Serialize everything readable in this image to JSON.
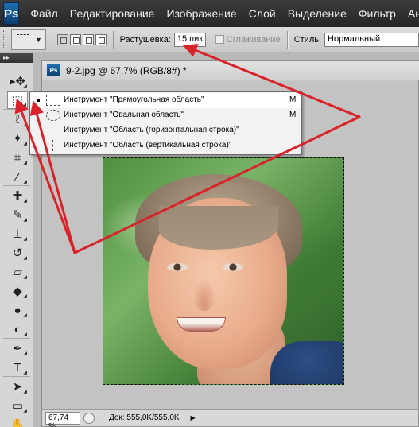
{
  "app": {
    "logo": "Ps"
  },
  "menu": [
    "Файл",
    "Редактирование",
    "Изображение",
    "Слой",
    "Выделение",
    "Фильтр",
    "Анализ"
  ],
  "options_bar": {
    "feather_label": "Растушевка:",
    "feather_value": "15 пик",
    "antialias_label": "Сглаживание",
    "style_label": "Стиль:",
    "style_value": "Нормальный"
  },
  "document": {
    "title": "9-2.jpg @ 67,7% (RGB/8#) *",
    "zoom": "67,74 %",
    "doc_info": "Док: 555,0K/555,0K"
  },
  "flyout": {
    "items": [
      {
        "label": "Инструмент \"Прямоугольная область\"",
        "key": "M",
        "icon": "rect-marquee-icon",
        "active": true
      },
      {
        "label": "Инструмент \"Овальная область\"",
        "key": "M",
        "icon": "ellipse-marquee-icon",
        "active": false
      },
      {
        "label": "Инструмент \"Область (горизонтальная строка)\"",
        "key": "",
        "icon": "single-row-marquee-icon",
        "active": false
      },
      {
        "label": "Инструмент \"Область (вертикальная строка)\"",
        "key": "",
        "icon": "single-column-marquee-icon",
        "active": false
      }
    ]
  },
  "toolbox": {
    "tools": [
      {
        "name": "move-tool-icon",
        "glyph": "▸✥"
      },
      {
        "name": "marquee-tool-icon",
        "glyph": "⬚",
        "selected": true
      },
      {
        "name": "lasso-tool-icon",
        "glyph": "ℓ"
      },
      {
        "name": "magic-wand-tool-icon",
        "glyph": "✦"
      },
      {
        "name": "crop-tool-icon",
        "glyph": "⌗"
      },
      {
        "name": "eyedropper-tool-icon",
        "glyph": "⁄"
      },
      {
        "name": "healing-brush-tool-icon",
        "glyph": "✚"
      },
      {
        "name": "brush-tool-icon",
        "glyph": "✎"
      },
      {
        "name": "clone-stamp-tool-icon",
        "glyph": "⊥"
      },
      {
        "name": "history-brush-tool-icon",
        "glyph": "↺"
      },
      {
        "name": "eraser-tool-icon",
        "glyph": "▱"
      },
      {
        "name": "paint-bucket-tool-icon",
        "glyph": "◆"
      },
      {
        "name": "blur-tool-icon",
        "glyph": "●"
      },
      {
        "name": "dodge-tool-icon",
        "glyph": "◐"
      },
      {
        "name": "pen-tool-icon",
        "glyph": "✒"
      },
      {
        "name": "type-tool-icon",
        "glyph": "T"
      },
      {
        "name": "path-selection-tool-icon",
        "glyph": "➤"
      },
      {
        "name": "shape-tool-icon",
        "glyph": "▭"
      },
      {
        "name": "hand-tool-icon",
        "glyph": "✋"
      }
    ]
  },
  "colors": {
    "annotation": "#d8232a",
    "menubar": "#2e2e2e"
  }
}
